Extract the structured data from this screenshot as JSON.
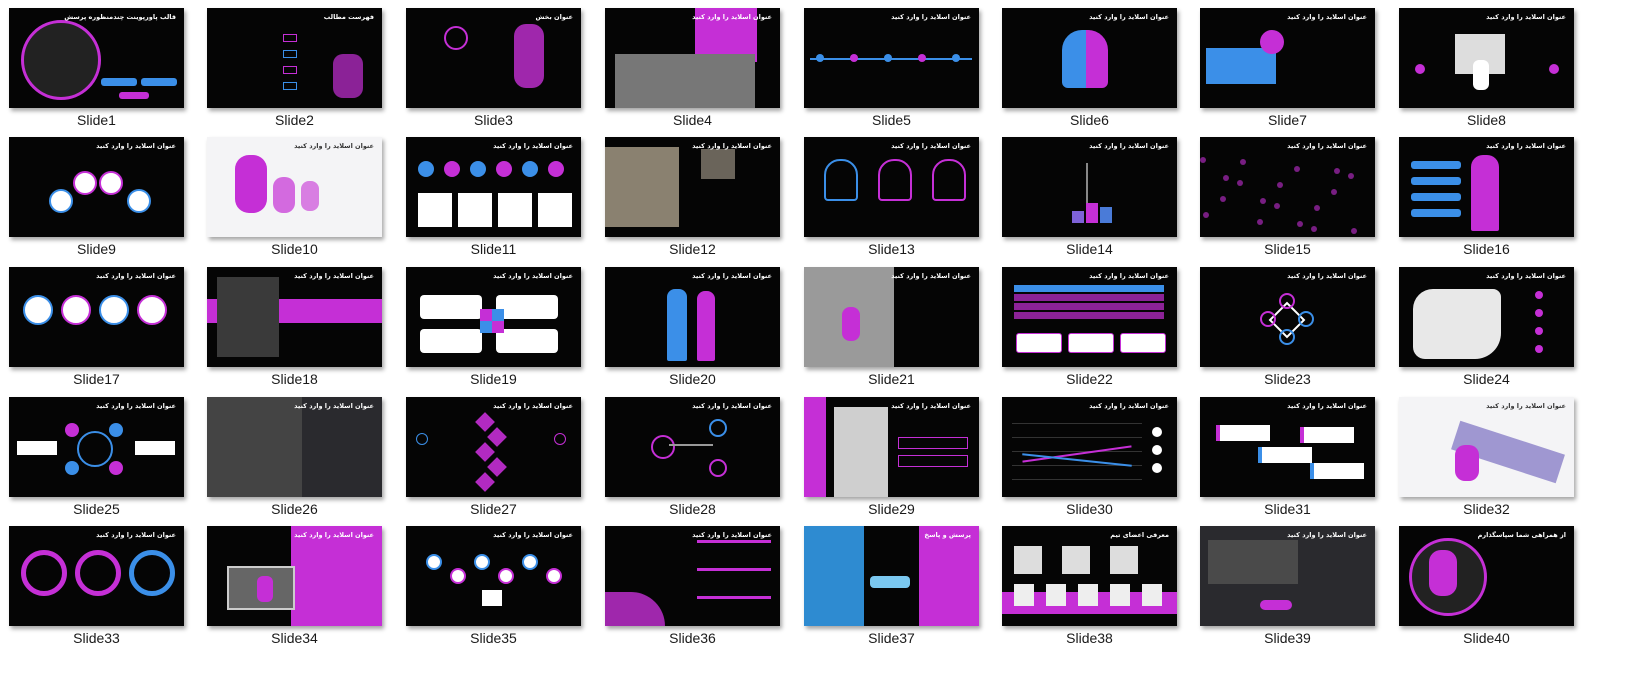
{
  "colors": {
    "accent": "#c52fd6",
    "blue": "#3b8fe8",
    "bg": "#050505",
    "light": "#f4f4f6"
  },
  "slides": [
    {
      "caption": "Slide1",
      "title": "قالب پاورپوینت چندمنظوره پرسش",
      "theme": "dark",
      "motif": "cover"
    },
    {
      "caption": "Slide2",
      "title": "فهرست مطالب",
      "theme": "dark",
      "motif": "toc"
    },
    {
      "caption": "Slide3",
      "title": "عنوان بخش",
      "theme": "dark",
      "motif": "section"
    },
    {
      "caption": "Slide4",
      "title": "عنوان اسلاید را وارد کنید",
      "theme": "dark",
      "motif": "quote"
    },
    {
      "caption": "Slide5",
      "title": "عنوان اسلاید را وارد کنید",
      "theme": "dark",
      "motif": "timeline"
    },
    {
      "caption": "Slide6",
      "title": "عنوان اسلاید را وارد کنید",
      "theme": "dark",
      "motif": "head"
    },
    {
      "caption": "Slide7",
      "title": "عنوان اسلاید را وارد کنید",
      "theme": "dark",
      "motif": "arrows"
    },
    {
      "caption": "Slide8",
      "title": "عنوان اسلاید را وارد کنید",
      "theme": "dark",
      "motif": "envelope"
    },
    {
      "caption": "Slide9",
      "title": "عنوان اسلاید را وارد کنید",
      "theme": "dark",
      "motif": "circles"
    },
    {
      "caption": "Slide10",
      "title": "عنوان اسلاید را وارد کنید",
      "theme": "light",
      "motif": "question"
    },
    {
      "caption": "Slide11",
      "title": "عنوان اسلاید را وارد کنید",
      "theme": "dark",
      "motif": "icons"
    },
    {
      "caption": "Slide12",
      "title": "عنوان اسلاید را وارد کنید",
      "theme": "dark",
      "motif": "photo"
    },
    {
      "caption": "Slide13",
      "title": "عنوان اسلاید را وارد کنید",
      "theme": "dark",
      "motif": "heads"
    },
    {
      "caption": "Slide14",
      "title": "عنوان اسلاید را وارد کنید",
      "theme": "dark",
      "motif": "tree"
    },
    {
      "caption": "Slide15",
      "title": "عنوان اسلاید را وارد کنید",
      "theme": "dark",
      "motif": "bokeh"
    },
    {
      "caption": "Slide16",
      "title": "عنوان اسلاید را وارد کنید",
      "theme": "dark",
      "motif": "figure"
    },
    {
      "caption": "Slide17",
      "title": "عنوان اسلاید را وارد کنید",
      "theme": "dark",
      "motif": "chain"
    },
    {
      "caption": "Slide18",
      "title": "عنوان اسلاید را وارد کنید",
      "theme": "dark",
      "motif": "band"
    },
    {
      "caption": "Slide19",
      "title": "عنوان اسلاید را وارد کنید",
      "theme": "dark",
      "motif": "swot"
    },
    {
      "caption": "Slide20",
      "title": "عنوان اسلاید را وارد کنید",
      "theme": "dark",
      "motif": "people"
    },
    {
      "caption": "Slide21",
      "title": "عنوان اسلاید را وارد کنید",
      "theme": "dark",
      "motif": "photo2"
    },
    {
      "caption": "Slide22",
      "title": "عنوان اسلاید را وارد کنید",
      "theme": "dark",
      "motif": "table"
    },
    {
      "caption": "Slide23",
      "title": "عنوان اسلاید را وارد کنید",
      "theme": "dark",
      "motif": "diamond"
    },
    {
      "caption": "Slide24",
      "title": "عنوان اسلاید را وارد کنید",
      "theme": "dark",
      "motif": "map"
    },
    {
      "caption": "Slide25",
      "title": "عنوان اسلاید را وارد کنید",
      "theme": "dark",
      "motif": "cycle"
    },
    {
      "caption": "Slide26",
      "title": "عنوان اسلاید را وارد کنید",
      "theme": "mid",
      "motif": "keyboard"
    },
    {
      "caption": "Slide27",
      "title": "عنوان اسلاید را وارد کنید",
      "theme": "dark",
      "motif": "hex"
    },
    {
      "caption": "Slide28",
      "title": "عنوان اسلاید را وارد کنید",
      "theme": "dark",
      "motif": "network"
    },
    {
      "caption": "Slide29",
      "title": "عنوان اسلاید را وارد کنید",
      "theme": "dark",
      "motif": "woman"
    },
    {
      "caption": "Slide30",
      "title": "عنوان اسلاید را وارد کنید",
      "theme": "dark",
      "motif": "line"
    },
    {
      "caption": "Slide31",
      "title": "عنوان اسلاید را وارد کنید",
      "theme": "dark",
      "motif": "steps"
    },
    {
      "caption": "Slide32",
      "title": "عنوان اسلاید را وارد کنید",
      "theme": "light",
      "motif": "solution"
    },
    {
      "caption": "Slide33",
      "title": "عنوان اسلاید را وارد کنید",
      "theme": "dark",
      "motif": "rings"
    },
    {
      "caption": "Slide34",
      "title": "عنوان اسلاید را وارد کنید",
      "theme": "dark",
      "motif": "laptop"
    },
    {
      "caption": "Slide35",
      "title": "عنوان اسلاید را وارد کنید",
      "theme": "dark",
      "motif": "hub"
    },
    {
      "caption": "Slide36",
      "title": "عنوان اسلاید را وارد کنید",
      "theme": "dark",
      "motif": "text"
    },
    {
      "caption": "Slide37",
      "title": "پرسش و پاسخ",
      "theme": "dark",
      "motif": "qa"
    },
    {
      "caption": "Slide38",
      "title": "معرفی اعضای تیم",
      "theme": "dark",
      "motif": "team"
    },
    {
      "caption": "Slide39",
      "title": "عنوان اسلاید را وارد کنید",
      "theme": "mid",
      "motif": "puzzle"
    },
    {
      "caption": "Slide40",
      "title": "از همراهی شما سپاسگذارم",
      "theme": "dark",
      "motif": "end"
    }
  ]
}
